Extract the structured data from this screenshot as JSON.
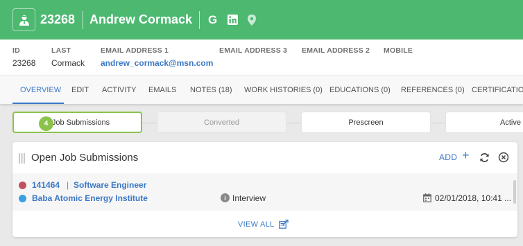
{
  "header": {
    "id": "23268",
    "name": "Andrew Cormack",
    "icons": [
      "candidate-avatar-icon",
      "google-icon",
      "linkedin-icon",
      "location-pin-icon"
    ],
    "google_glyph": "G",
    "linkedin_glyph": "in",
    "bg_color": "#4cb870"
  },
  "info": {
    "columns": [
      {
        "label": "ID",
        "value": "23268"
      },
      {
        "label": "LAST",
        "value": "Cormack"
      },
      {
        "label": "EMAIL ADDRESS 1",
        "value": "andrew_cormack@msn.com"
      },
      {
        "label": "EMAIL ADDRESS 3",
        "value": ""
      },
      {
        "label": "EMAIL ADDRESS 2",
        "value": ""
      },
      {
        "label": "MOBILE",
        "value": ""
      }
    ]
  },
  "tabs": [
    {
      "label": "OVERVIEW",
      "active": true
    },
    {
      "label": "EDIT"
    },
    {
      "label": "ACTIVITY"
    },
    {
      "label": "EMAILS"
    },
    {
      "label": "NOTES (18)"
    },
    {
      "label": "WORK HISTORIES (0)"
    },
    {
      "label": "EDUCATIONS (0)"
    },
    {
      "label": "REFERENCES (0)"
    },
    {
      "label": "CERTIFICATION"
    }
  ],
  "pipeline": {
    "count": "4",
    "stages": [
      "Job Submissions",
      "Converted",
      "Prescreen",
      "Active"
    ],
    "accent": "#8bc34a"
  },
  "card": {
    "title": "Open Job Submissions",
    "add_label": "ADD",
    "plus": "+",
    "submission": {
      "job_id": "141464",
      "separator": "|",
      "job_title": "Software Engineer",
      "company": "Baba Atomic Energy Institute",
      "status": "Interview",
      "status_icon_glyph": "i",
      "date": "02/01/2018, 10:41 ...",
      "job_dot_color": "#c0515f",
      "company_dot_color": "#3ca0e0"
    },
    "view_all_label": "VIEW ALL"
  }
}
